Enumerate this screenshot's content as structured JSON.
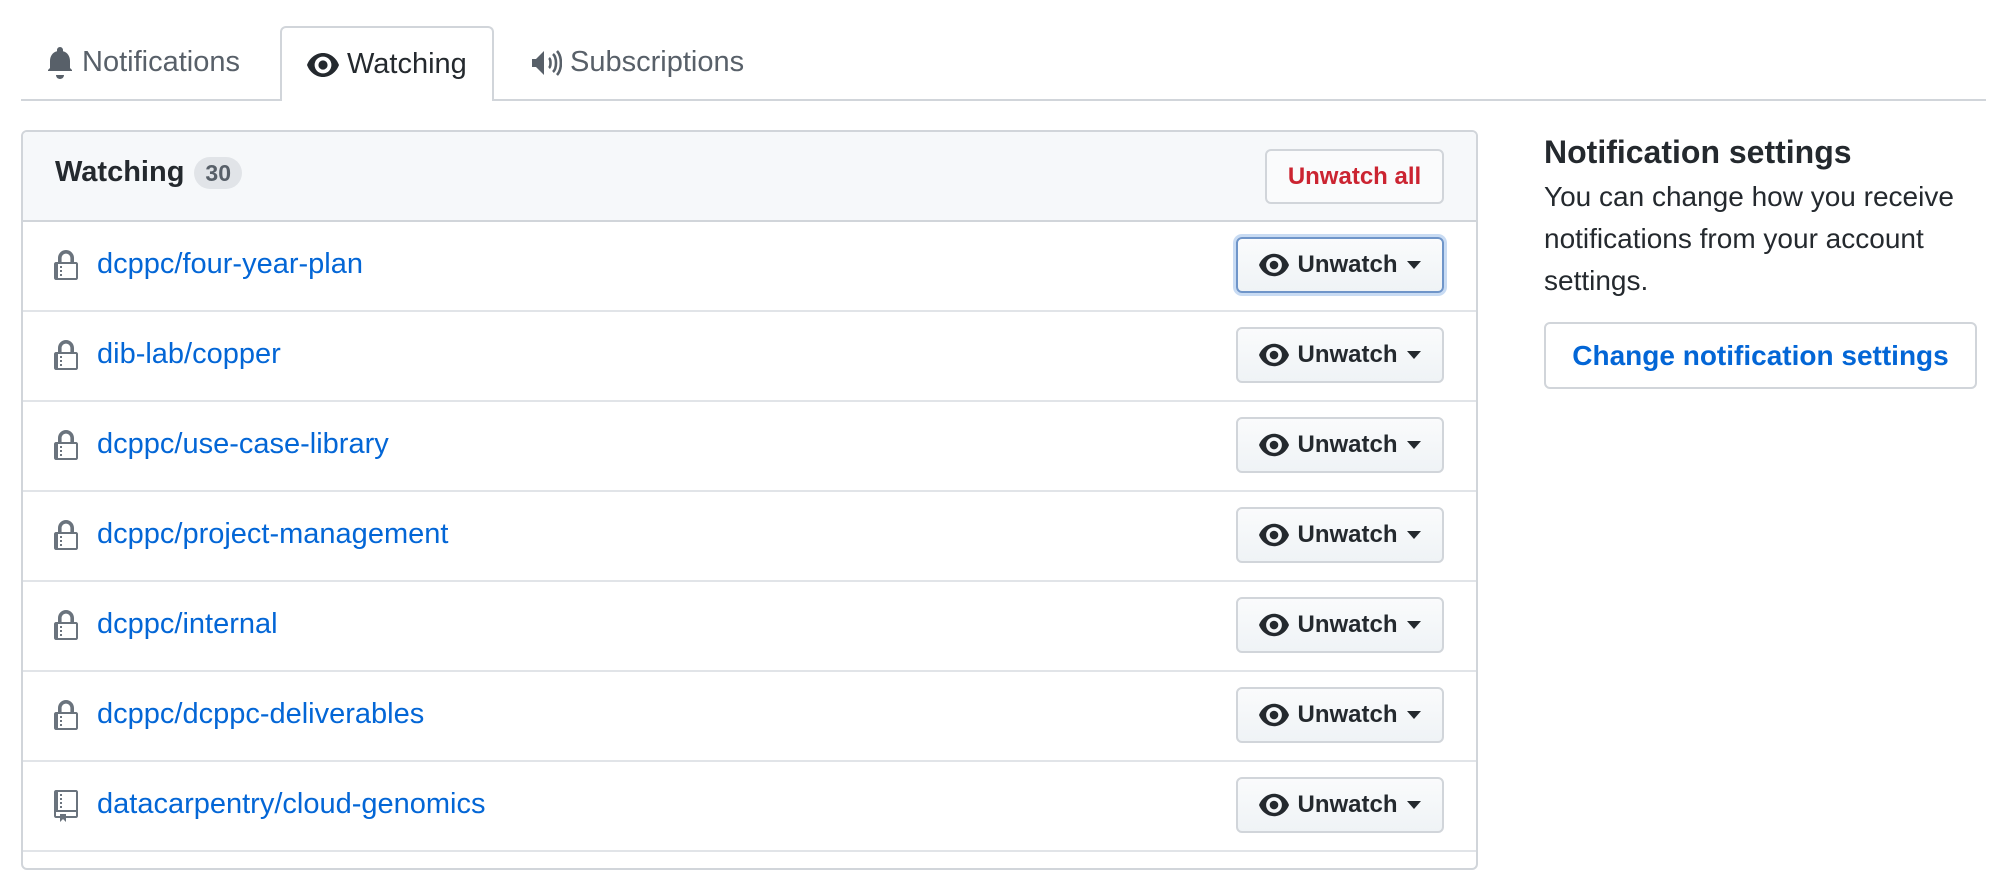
{
  "tabs": [
    {
      "label": "Notifications",
      "icon": "bell-icon"
    },
    {
      "label": "Watching",
      "icon": "eye-icon"
    },
    {
      "label": "Subscriptions",
      "icon": "megaphone-icon"
    }
  ],
  "watching": {
    "title": "Watching",
    "count": "30",
    "unwatch_all_label": "Unwatch all",
    "repos": [
      {
        "name": "dcppc/four-year-plan",
        "icon": "lock-icon",
        "button": "Unwatch"
      },
      {
        "name": "dib-lab/copper",
        "icon": "lock-icon",
        "button": "Unwatch"
      },
      {
        "name": "dcppc/use-case-library",
        "icon": "lock-icon",
        "button": "Unwatch"
      },
      {
        "name": "dcppc/project-management",
        "icon": "lock-icon",
        "button": "Unwatch"
      },
      {
        "name": "dcppc/internal",
        "icon": "lock-icon",
        "button": "Unwatch"
      },
      {
        "name": "dcppc/dcppc-deliverables",
        "icon": "lock-icon",
        "button": "Unwatch"
      },
      {
        "name": "datacarpentry/cloud-genomics",
        "icon": "repo-icon",
        "button": "Unwatch"
      }
    ]
  },
  "sidebar": {
    "title": "Notification settings",
    "description": "You can change how you receive notifications from your account settings.",
    "button_label": "Change notification settings"
  },
  "colors": {
    "link": "#0366d6",
    "danger": "#cb2431",
    "border": "#d1d5da"
  }
}
